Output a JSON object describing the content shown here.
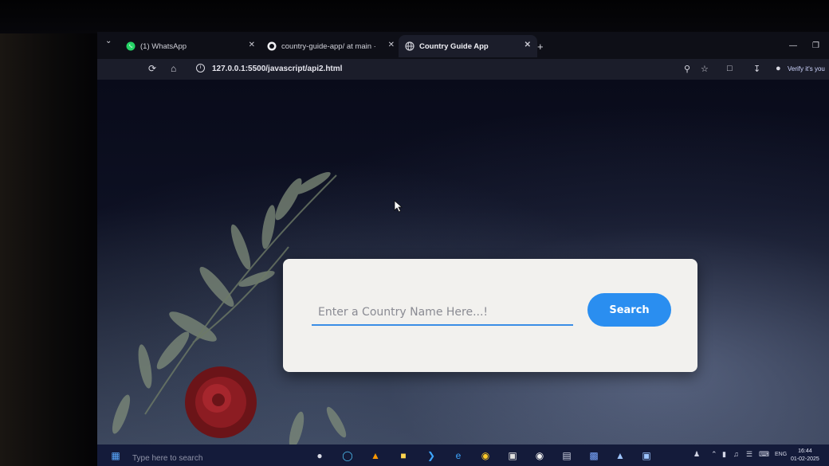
{
  "browser": {
    "tabs": [
      {
        "label": "(1) WhatsApp",
        "icon": "whatsapp-icon",
        "active": false
      },
      {
        "label": "country-guide-app/ at main ·",
        "icon": "github-icon",
        "active": false
      },
      {
        "label": "Country Guide App",
        "icon": "globe-icon",
        "active": true
      }
    ],
    "new_tab": "+",
    "url": "127.0.0.1:5500/javascript/api2.html",
    "profile_label": "Verify it's you"
  },
  "page": {
    "search": {
      "placeholder": "Enter a Country Name Here...!",
      "value": "",
      "button_label": "Search"
    }
  },
  "taskbar": {
    "search_placeholder": "Type here to search",
    "language": "ENG",
    "time": "16:44",
    "date": "01-02-2025"
  },
  "colors": {
    "accent": "#2a8ef0",
    "card_bg": "#f2f1ee",
    "tab_active_bg": "#1b1d2a"
  }
}
